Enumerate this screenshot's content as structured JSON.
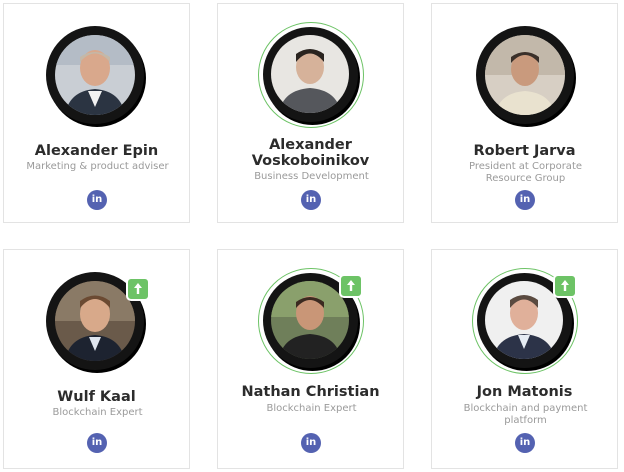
{
  "team": [
    {
      "name": "Alexander Epin",
      "title": "Marketing & product adviser",
      "social": "in",
      "badge": false
    },
    {
      "name": "Alexander Voskoboinikov",
      "name_line1": "Alexander",
      "name_line2": "Voskoboinikov",
      "title": "Business Development",
      "social": "in",
      "badge": false
    },
    {
      "name": "Robert Jarva",
      "title": "President at Corporate Resource Group",
      "title_line1": "President at Corporate",
      "title_line2": "Resource Group",
      "social": "in",
      "badge": false
    },
    {
      "name": "Wulf Kaal",
      "title": "Blockchain Expert",
      "social": "in",
      "badge": true
    },
    {
      "name": "Nathan Christian",
      "title": "Blockchain Expert",
      "social": "in",
      "badge": true
    },
    {
      "name": "Jon Matonis",
      "title": "Blockchain and payment platform",
      "title_line1": "Blockchain and payment",
      "title_line2": "platform",
      "social": "in",
      "badge": true
    }
  ],
  "icons": {
    "linkedin": "linkedin-icon",
    "badge": "arrow-up-icon"
  },
  "colors": {
    "linkedin": "#5462b1",
    "badge": "#6dc366",
    "name": "#2c2c2c",
    "title": "#9a9a9a"
  }
}
